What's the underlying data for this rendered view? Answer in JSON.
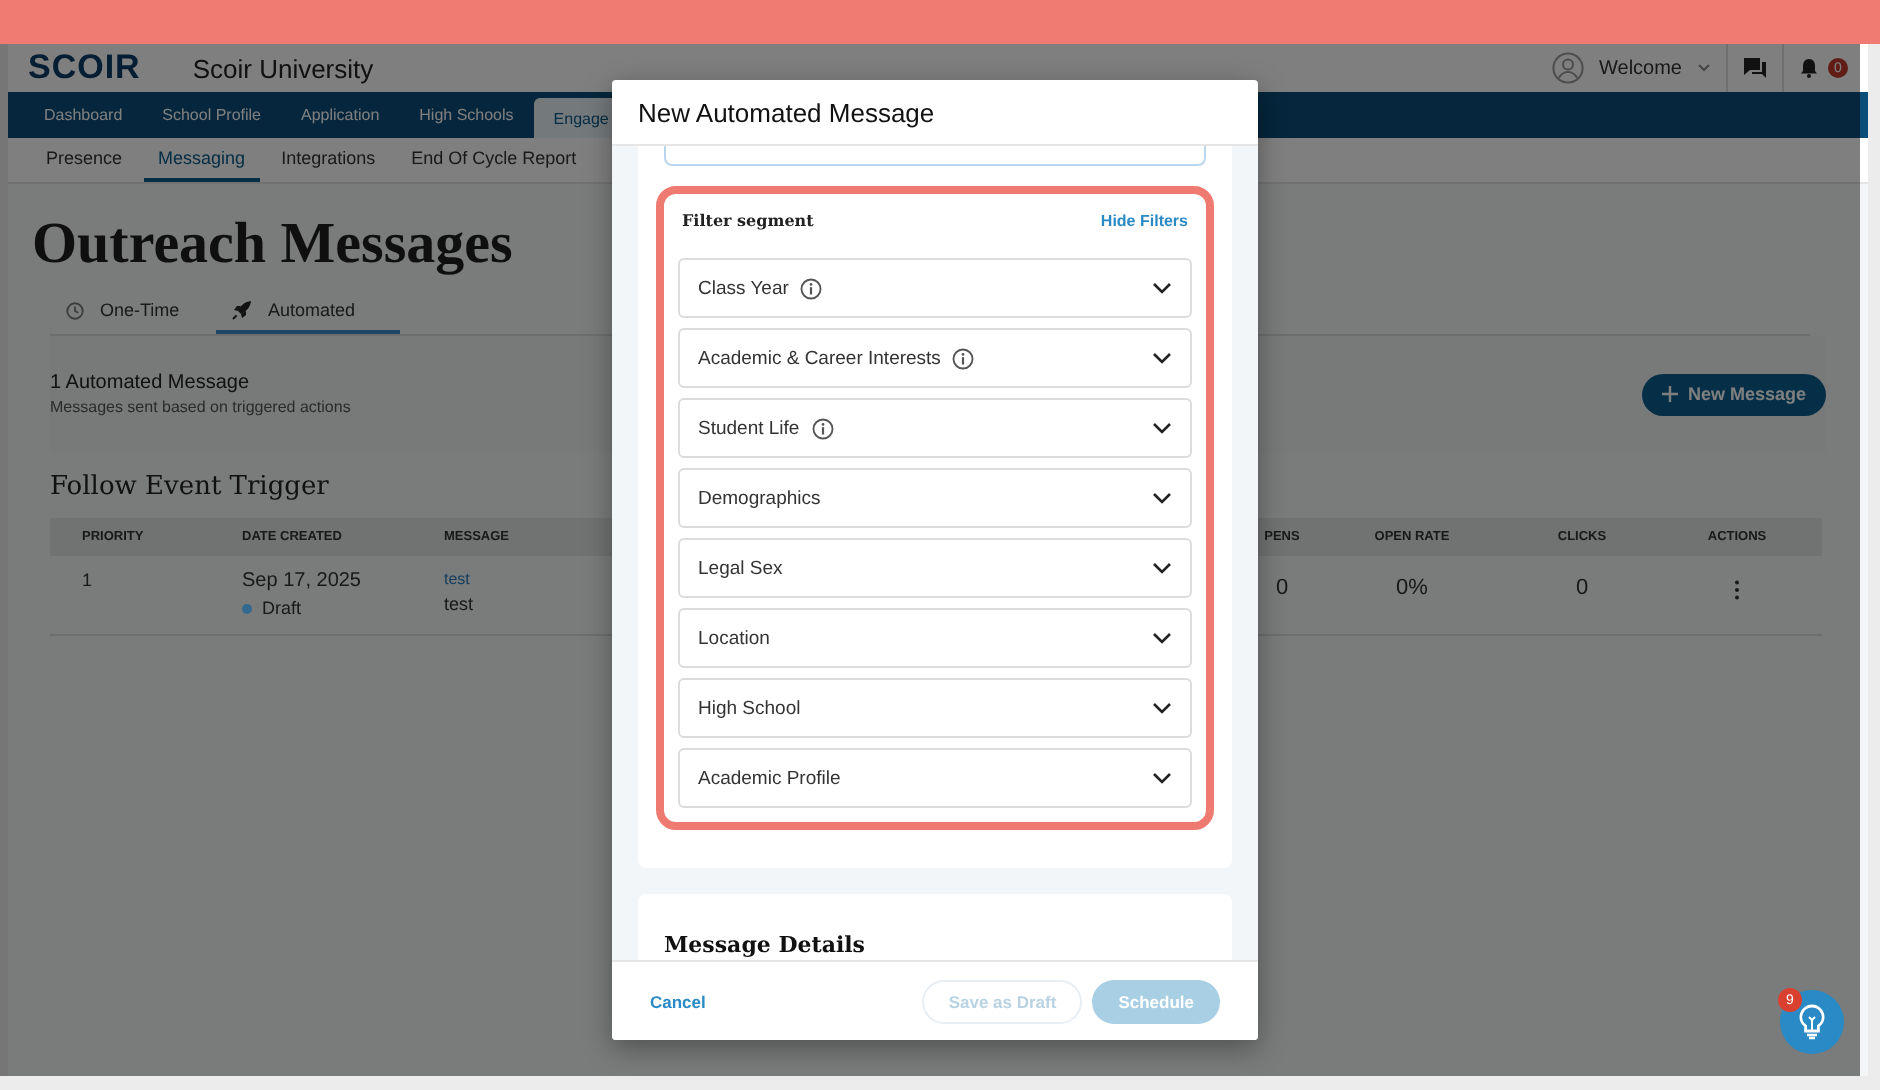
{
  "header": {
    "logo": "SCOIR",
    "org": "Scoir University",
    "welcome": "Welcome",
    "notification_count": "0"
  },
  "nav": [
    {
      "label": "Dashboard",
      "selected": false
    },
    {
      "label": "School Profile",
      "selected": false
    },
    {
      "label": "Application",
      "selected": false
    },
    {
      "label": "High Schools",
      "selected": false
    },
    {
      "label": "Engage",
      "selected": true
    }
  ],
  "subnav": [
    {
      "label": "Presence",
      "selected": false
    },
    {
      "label": "Messaging",
      "selected": true
    },
    {
      "label": "Integrations",
      "selected": false
    },
    {
      "label": "End Of Cycle Report",
      "selected": false
    }
  ],
  "page_title": "Outreach Messages",
  "message_tabs": [
    {
      "label": "One-Time",
      "kind": "clock",
      "selected": false
    },
    {
      "label": "Automated",
      "kind": "rocket",
      "selected": true
    }
  ],
  "summary": {
    "title": "1 Automated Message",
    "subtitle": "Messages sent based on triggered actions",
    "button": "New Message"
  },
  "section_title": "Follow Event Trigger",
  "table": {
    "columns_left": [
      "PRIORITY",
      "DATE CREATED",
      "MESSAGE"
    ],
    "columns_right": [
      "PENS",
      "OPEN RATE",
      "CLICKS",
      "ACTIONS"
    ],
    "rows": [
      {
        "priority": "1",
        "date": "Sep 17, 2025",
        "status": "Draft",
        "color": "#34698f",
        "message_link": "test",
        "message_text": "test",
        "opens": "0",
        "open_rate": "0%",
        "clicks": "0"
      }
    ]
  },
  "modal": {
    "title": "New Automated Message",
    "filter_title": "Filter segment",
    "hide_filters": "Hide Filters",
    "filters": [
      {
        "label": "Class Year",
        "info_icon": true
      },
      {
        "label": "Academic & Career Interests",
        "info_icon": true
      },
      {
        "label": "Student Life",
        "info_icon": true
      },
      {
        "label": "Demographics",
        "info_icon": false
      },
      {
        "label": "Legal Sex",
        "info_icon": false
      },
      {
        "label": "Location",
        "info_icon": false
      },
      {
        "label": "High School",
        "info_icon": false
      },
      {
        "label": "Academic Profile",
        "info_icon": false
      }
    ],
    "details_title": "Message Details",
    "cancel": "Cancel",
    "buttons": [
      {
        "label": "Save as Draft",
        "kind": "outline",
        "disabled": true
      },
      {
        "label": "Schedule",
        "kind": "primary",
        "disabled": true
      }
    ]
  },
  "help_badge": "9"
}
